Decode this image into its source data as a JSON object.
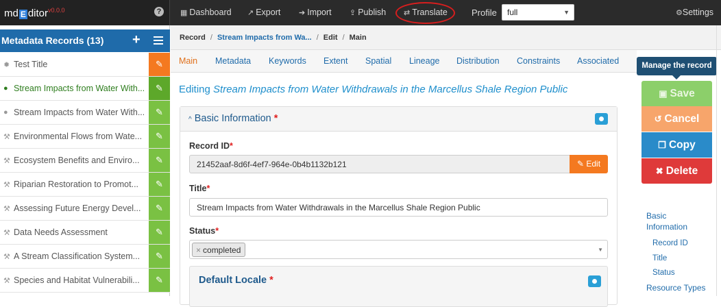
{
  "app": {
    "logo_prefix": "md",
    "logo_e": "E",
    "logo_suffix": "ditor",
    "version": "v0.0.0",
    "help_glyph": "?"
  },
  "topnav": {
    "items": [
      {
        "label": "Dashboard",
        "icon": "dashboard-icon"
      },
      {
        "label": "Export",
        "icon": "export-icon"
      },
      {
        "label": "Import",
        "icon": "import-icon"
      },
      {
        "label": "Publish",
        "icon": "publish-icon"
      },
      {
        "label": "Translate",
        "icon": "translate-icon"
      }
    ],
    "profile_label": "Profile",
    "profile_value": "full",
    "settings_label": "Settings"
  },
  "sidebar": {
    "title": "Metadata Records (13)",
    "records": [
      {
        "label": "Test Title",
        "icon": "gear-icon",
        "state": "test"
      },
      {
        "label": "Stream Impacts from Water With...",
        "icon": "globe-icon",
        "state": "active"
      },
      {
        "label": "Stream Impacts from Water With...",
        "icon": "globe-icon",
        "state": "normal"
      },
      {
        "label": "Environmental Flows from Wate...",
        "icon": "wrench-icon",
        "state": "normal"
      },
      {
        "label": "Ecosystem Benefits and Enviro...",
        "icon": "wrench-icon",
        "state": "normal"
      },
      {
        "label": "Riparian Restoration to Promot...",
        "icon": "wrench-icon",
        "state": "normal"
      },
      {
        "label": "Assessing Future Energy Devel...",
        "icon": "wrench-icon",
        "state": "normal"
      },
      {
        "label": "Data Needs Assessment",
        "icon": "wrench-icon",
        "state": "normal"
      },
      {
        "label": "A Stream Classification System...",
        "icon": "wrench-icon",
        "state": "normal"
      },
      {
        "label": "Species and Habitat Vulnerabili...",
        "icon": "wrench-icon",
        "state": "normal"
      }
    ]
  },
  "breadcrumb": {
    "record": "Record",
    "title": "Stream Impacts from Wa...",
    "edit": "Edit",
    "main": "Main"
  },
  "tabs": [
    "Main",
    "Metadata",
    "Keywords",
    "Extent",
    "Spatial",
    "Lineage",
    "Distribution",
    "Constraints",
    "Associated"
  ],
  "content": {
    "editing_prefix": "Editing",
    "editing_title": "Stream Impacts from Water Withdrawals in the Marcellus Shale Region Public",
    "panel_title": "Basic Information",
    "record_id_label": "Record ID",
    "record_id_value": "21452aaf-8d6f-4ef7-964e-0b4b1132b121",
    "edit_button": "Edit",
    "title_label": "Title",
    "title_value": "Stream Impacts from Water Withdrawals in the Marcellus Shale Region Public",
    "status_label": "Status",
    "status_tag": "completed",
    "status_tag_remove": "×",
    "locale_title": "Default Locale",
    "required_mark": "*"
  },
  "actions": {
    "tooltip": "Manage the record",
    "save": "Save",
    "cancel": "Cancel",
    "copy": "Copy",
    "delete": "Delete"
  },
  "outline": {
    "heading": "Basic Information",
    "items": [
      "Record ID",
      "Title",
      "Status"
    ],
    "next": "Resource Types"
  },
  "colors": {
    "accent_blue": "#1f6baa",
    "record_edit_green": "#7ac143",
    "orange": "#f47920",
    "delete_red": "#df3a3a",
    "highlight_ring": "#d81e1e"
  }
}
